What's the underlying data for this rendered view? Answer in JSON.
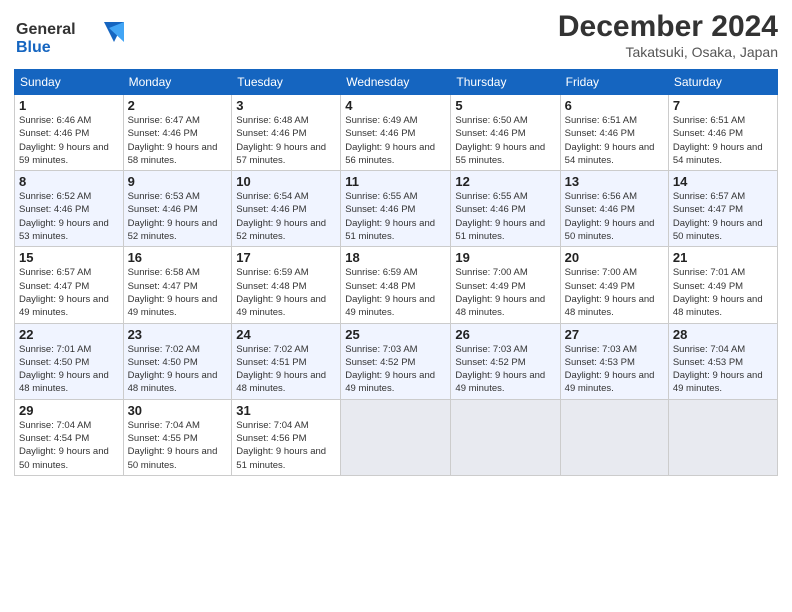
{
  "header": {
    "logo_line1": "General",
    "logo_line2": "Blue",
    "month_year": "December 2024",
    "location": "Takatsuki, Osaka, Japan"
  },
  "weekdays": [
    "Sunday",
    "Monday",
    "Tuesday",
    "Wednesday",
    "Thursday",
    "Friday",
    "Saturday"
  ],
  "weeks": [
    [
      {
        "day": "1",
        "sunrise": "Sunrise: 6:46 AM",
        "sunset": "Sunset: 4:46 PM",
        "daylight": "Daylight: 9 hours and 59 minutes."
      },
      {
        "day": "2",
        "sunrise": "Sunrise: 6:47 AM",
        "sunset": "Sunset: 4:46 PM",
        "daylight": "Daylight: 9 hours and 58 minutes."
      },
      {
        "day": "3",
        "sunrise": "Sunrise: 6:48 AM",
        "sunset": "Sunset: 4:46 PM",
        "daylight": "Daylight: 9 hours and 57 minutes."
      },
      {
        "day": "4",
        "sunrise": "Sunrise: 6:49 AM",
        "sunset": "Sunset: 4:46 PM",
        "daylight": "Daylight: 9 hours and 56 minutes."
      },
      {
        "day": "5",
        "sunrise": "Sunrise: 6:50 AM",
        "sunset": "Sunset: 4:46 PM",
        "daylight": "Daylight: 9 hours and 55 minutes."
      },
      {
        "day": "6",
        "sunrise": "Sunrise: 6:51 AM",
        "sunset": "Sunset: 4:46 PM",
        "daylight": "Daylight: 9 hours and 54 minutes."
      },
      {
        "day": "7",
        "sunrise": "Sunrise: 6:51 AM",
        "sunset": "Sunset: 4:46 PM",
        "daylight": "Daylight: 9 hours and 54 minutes."
      }
    ],
    [
      {
        "day": "8",
        "sunrise": "Sunrise: 6:52 AM",
        "sunset": "Sunset: 4:46 PM",
        "daylight": "Daylight: 9 hours and 53 minutes."
      },
      {
        "day": "9",
        "sunrise": "Sunrise: 6:53 AM",
        "sunset": "Sunset: 4:46 PM",
        "daylight": "Daylight: 9 hours and 52 minutes."
      },
      {
        "day": "10",
        "sunrise": "Sunrise: 6:54 AM",
        "sunset": "Sunset: 4:46 PM",
        "daylight": "Daylight: 9 hours and 52 minutes."
      },
      {
        "day": "11",
        "sunrise": "Sunrise: 6:55 AM",
        "sunset": "Sunset: 4:46 PM",
        "daylight": "Daylight: 9 hours and 51 minutes."
      },
      {
        "day": "12",
        "sunrise": "Sunrise: 6:55 AM",
        "sunset": "Sunset: 4:46 PM",
        "daylight": "Daylight: 9 hours and 51 minutes."
      },
      {
        "day": "13",
        "sunrise": "Sunrise: 6:56 AM",
        "sunset": "Sunset: 4:46 PM",
        "daylight": "Daylight: 9 hours and 50 minutes."
      },
      {
        "day": "14",
        "sunrise": "Sunrise: 6:57 AM",
        "sunset": "Sunset: 4:47 PM",
        "daylight": "Daylight: 9 hours and 50 minutes."
      }
    ],
    [
      {
        "day": "15",
        "sunrise": "Sunrise: 6:57 AM",
        "sunset": "Sunset: 4:47 PM",
        "daylight": "Daylight: 9 hours and 49 minutes."
      },
      {
        "day": "16",
        "sunrise": "Sunrise: 6:58 AM",
        "sunset": "Sunset: 4:47 PM",
        "daylight": "Daylight: 9 hours and 49 minutes."
      },
      {
        "day": "17",
        "sunrise": "Sunrise: 6:59 AM",
        "sunset": "Sunset: 4:48 PM",
        "daylight": "Daylight: 9 hours and 49 minutes."
      },
      {
        "day": "18",
        "sunrise": "Sunrise: 6:59 AM",
        "sunset": "Sunset: 4:48 PM",
        "daylight": "Daylight: 9 hours and 49 minutes."
      },
      {
        "day": "19",
        "sunrise": "Sunrise: 7:00 AM",
        "sunset": "Sunset: 4:49 PM",
        "daylight": "Daylight: 9 hours and 48 minutes."
      },
      {
        "day": "20",
        "sunrise": "Sunrise: 7:00 AM",
        "sunset": "Sunset: 4:49 PM",
        "daylight": "Daylight: 9 hours and 48 minutes."
      },
      {
        "day": "21",
        "sunrise": "Sunrise: 7:01 AM",
        "sunset": "Sunset: 4:49 PM",
        "daylight": "Daylight: 9 hours and 48 minutes."
      }
    ],
    [
      {
        "day": "22",
        "sunrise": "Sunrise: 7:01 AM",
        "sunset": "Sunset: 4:50 PM",
        "daylight": "Daylight: 9 hours and 48 minutes."
      },
      {
        "day": "23",
        "sunrise": "Sunrise: 7:02 AM",
        "sunset": "Sunset: 4:50 PM",
        "daylight": "Daylight: 9 hours and 48 minutes."
      },
      {
        "day": "24",
        "sunrise": "Sunrise: 7:02 AM",
        "sunset": "Sunset: 4:51 PM",
        "daylight": "Daylight: 9 hours and 48 minutes."
      },
      {
        "day": "25",
        "sunrise": "Sunrise: 7:03 AM",
        "sunset": "Sunset: 4:52 PM",
        "daylight": "Daylight: 9 hours and 49 minutes."
      },
      {
        "day": "26",
        "sunrise": "Sunrise: 7:03 AM",
        "sunset": "Sunset: 4:52 PM",
        "daylight": "Daylight: 9 hours and 49 minutes."
      },
      {
        "day": "27",
        "sunrise": "Sunrise: 7:03 AM",
        "sunset": "Sunset: 4:53 PM",
        "daylight": "Daylight: 9 hours and 49 minutes."
      },
      {
        "day": "28",
        "sunrise": "Sunrise: 7:04 AM",
        "sunset": "Sunset: 4:53 PM",
        "daylight": "Daylight: 9 hours and 49 minutes."
      }
    ],
    [
      {
        "day": "29",
        "sunrise": "Sunrise: 7:04 AM",
        "sunset": "Sunset: 4:54 PM",
        "daylight": "Daylight: 9 hours and 50 minutes."
      },
      {
        "day": "30",
        "sunrise": "Sunrise: 7:04 AM",
        "sunset": "Sunset: 4:55 PM",
        "daylight": "Daylight: 9 hours and 50 minutes."
      },
      {
        "day": "31",
        "sunrise": "Sunrise: 7:04 AM",
        "sunset": "Sunset: 4:56 PM",
        "daylight": "Daylight: 9 hours and 51 minutes."
      },
      null,
      null,
      null,
      null
    ]
  ]
}
